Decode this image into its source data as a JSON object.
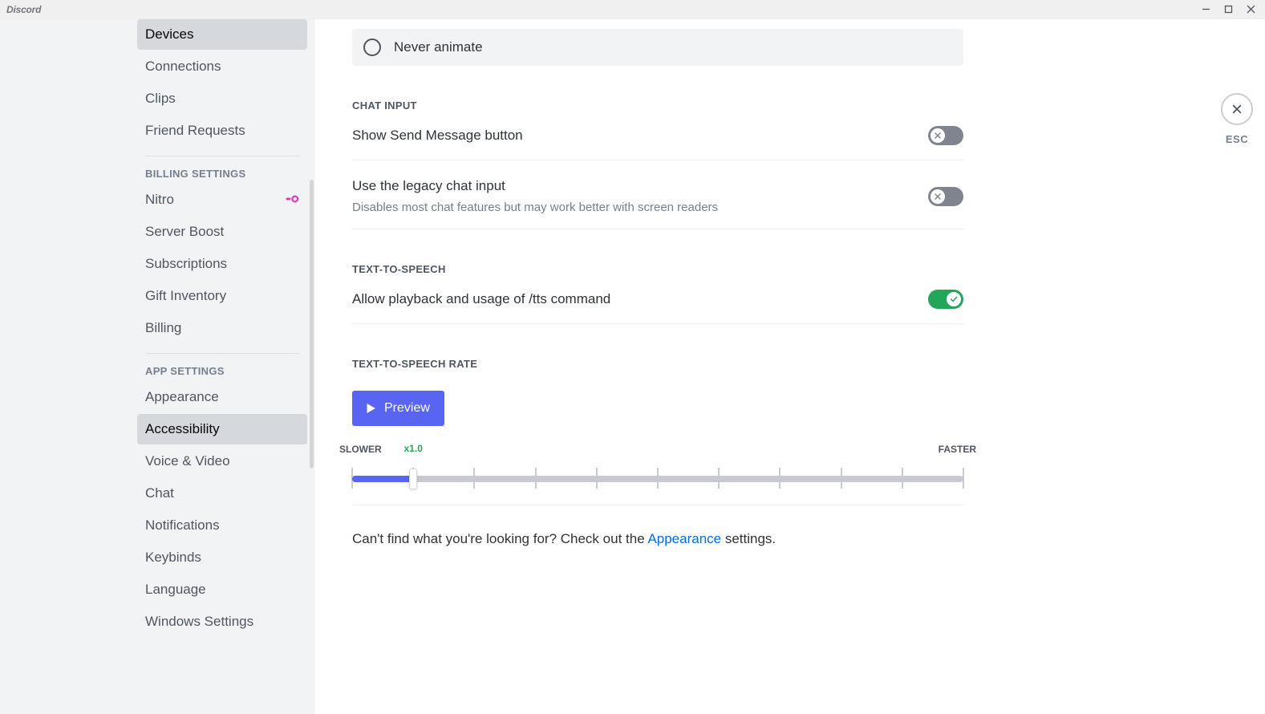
{
  "titlebar": {
    "title": "Discord"
  },
  "close": {
    "label": "ESC"
  },
  "sidebar": {
    "items_top": [
      {
        "label": "Devices",
        "selected": true
      },
      {
        "label": "Connections"
      },
      {
        "label": "Clips"
      },
      {
        "label": "Friend Requests"
      }
    ],
    "billing_heading": "BILLING SETTINGS",
    "items_billing": [
      {
        "label": "Nitro",
        "icon": "nitro"
      },
      {
        "label": "Server Boost"
      },
      {
        "label": "Subscriptions"
      },
      {
        "label": "Gift Inventory"
      },
      {
        "label": "Billing"
      }
    ],
    "app_heading": "APP SETTINGS",
    "items_app": [
      {
        "label": "Appearance"
      },
      {
        "label": "Accessibility",
        "selected": true
      },
      {
        "label": "Voice & Video"
      },
      {
        "label": "Chat"
      },
      {
        "label": "Notifications"
      },
      {
        "label": "Keybinds"
      },
      {
        "label": "Language"
      },
      {
        "label": "Windows Settings"
      }
    ]
  },
  "content": {
    "radio": {
      "never_animate": "Never animate"
    },
    "chat_input_heading": "CHAT INPUT",
    "show_send": {
      "label": "Show Send Message button",
      "value": false
    },
    "legacy_input": {
      "label": "Use the legacy chat input",
      "desc": "Disables most chat features but may work better with screen readers",
      "value": false
    },
    "tts_heading": "TEXT-TO-SPEECH",
    "tts_allow": {
      "label": "Allow playback and usage of /tts command",
      "value": true
    },
    "tts_rate_heading": "TEXT-TO-SPEECH RATE",
    "preview_label": "Preview",
    "slider": {
      "slower": "SLOWER",
      "faster": "FASTER",
      "value_label": "x1.0",
      "value_pct": 10,
      "ticks_pct": [
        0,
        10,
        20,
        30,
        40,
        50,
        60,
        70,
        80,
        90,
        100
      ]
    },
    "footnote_prefix": "Can't find what you're looking for? Check out the ",
    "footnote_link": "Appearance",
    "footnote_suffix": " settings."
  }
}
